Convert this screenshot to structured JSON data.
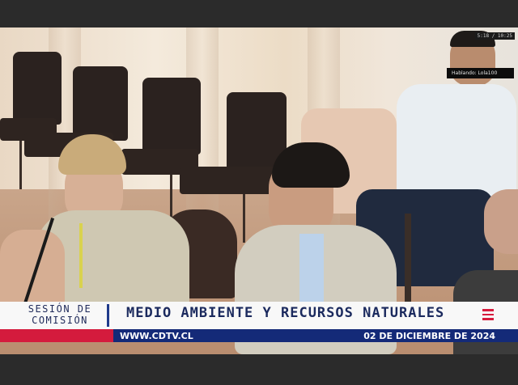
{
  "video": {
    "timestamp": "5:18 / 10:25",
    "speaker_label": "Hablando: Lola100"
  },
  "lower_third": {
    "session_label_line1": "SESIÓN DE",
    "session_label_line2": "COMISIÓN",
    "commission_title": "MEDIO AMBIENTE Y RECURSOS NATURALES",
    "website": "WWW.CDTV.CL",
    "date": "02 DE DICIEMBRE DE 2024",
    "menu_icon": "hamburger-icon"
  },
  "colors": {
    "navy": "#142a78",
    "title_text": "#1b2a5e",
    "accent_red": "#d41b3d",
    "bar_dark": "#2b2b2b"
  }
}
